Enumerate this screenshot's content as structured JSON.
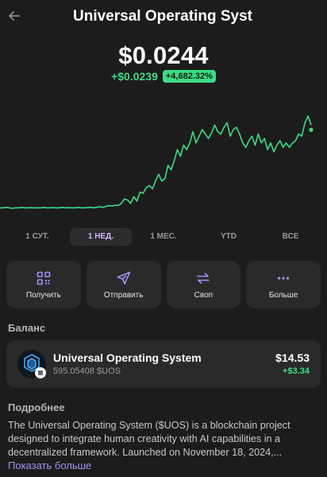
{
  "header": {
    "title": "Universal Operating Syst"
  },
  "price": {
    "value": "$0.0244",
    "change_abs": "+$0.0239",
    "change_pct": "+4,682.32%"
  },
  "chart_data": {
    "type": "line",
    "color": "#3ddc84",
    "values": [
      1.0,
      1.0,
      1.02,
      1.0,
      0.98,
      1.0,
      1.0,
      1.02,
      1.0,
      1.0,
      1.01,
      1.0,
      1.0,
      1.0,
      1.02,
      1.0,
      1.0,
      1.01,
      1.0,
      1.0,
      1.02,
      1.0,
      1.01,
      1.0,
      1.0,
      1.02,
      1.0,
      1.0,
      1.01,
      1.03,
      1.0,
      1.02,
      1.05,
      1.02,
      1.06,
      1.1,
      1.08,
      1.12,
      1.1,
      1.2,
      1.4,
      1.35,
      1.2,
      1.5,
      1.3,
      1.7,
      1.65,
      1.9,
      2.0,
      1.85,
      2.2,
      2.5,
      2.2,
      2.3,
      2.9,
      2.7,
      3.1,
      3.6,
      3.3,
      3.8,
      3.6,
      3.9,
      4.4,
      3.9,
      4.2,
      4.5,
      4.3,
      4.1,
      4.35,
      4.7,
      4.4,
      4.3,
      4.6,
      4.8,
      4.2,
      4.5,
      4.6,
      4.3,
      3.9,
      3.7,
      4.0,
      4.2,
      3.8,
      4.3,
      3.9,
      4.1,
      3.6,
      3.9,
      3.5,
      3.8,
      4.0,
      3.7,
      3.9,
      3.7,
      3.9,
      4.0,
      4.3,
      4.2,
      4.8,
      5.1,
      4.7
    ]
  },
  "tabs": [
    "1 СУТ.",
    "1 НЕД.",
    "1 МЕС.",
    "YTD",
    "ВСЕ"
  ],
  "active_tab": "1 НЕД.",
  "actions": {
    "receive": "Получить",
    "send": "Отправить",
    "swap": "Своп",
    "more": "Больше"
  },
  "balance": {
    "section_title": "Баланс",
    "token_name": "Universal Operating System",
    "token_amount": "595.05408 $UOS",
    "token_value": "$14.53",
    "token_change": "+$3.34"
  },
  "about": {
    "section_title": "Подробнее",
    "text": "The Universal Operating System ($UOS) is a blockchain project designed to integrate human creativity with AI capabilities in a decentralized framework. Launched on November 18, 2024,...",
    "show_more": "Показать больше"
  },
  "colors": {
    "accent": "#a693f7",
    "positive": "#3ddc84",
    "background": "#1c1c1c"
  },
  "icons": {
    "back": "arrow-left-icon",
    "receive": "qr-code-icon",
    "send": "paper-plane-icon",
    "swap": "swap-arrows-icon",
    "more": "ellipsis-icon"
  }
}
